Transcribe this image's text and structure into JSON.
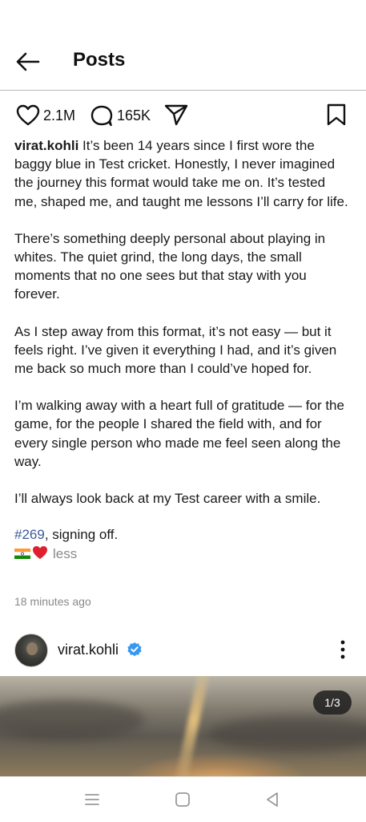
{
  "header": {
    "title": "Posts"
  },
  "actions": {
    "likes": "2.1M",
    "comments": "165K"
  },
  "caption": {
    "username": "virat.kohli",
    "paragraphs": [
      "It’s been 14 years since I first wore the baggy blue in Test cricket. Honestly, I never imagined the journey this format would take me on. It’s tested me, shaped me, and taught me lessons I’ll carry for life.",
      "There’s something deeply personal about playing in whites. The quiet grind, the long days, the small moments that no one sees but that stay with you forever.",
      "As I step away from this format, it’s not easy — but it feels right. I’ve given it everything I had, and it’s given me back so much more than I could’ve hoped for.",
      "I’m walking away with a heart full of gratitude — for the game, for the people I shared the field with, and for every single person who made me feel seen along the way.",
      "I’ll always look back at my Test career with a smile."
    ],
    "hashtag": "#269",
    "hashtag_suffix": ", signing off.",
    "less": "less",
    "emoji_icons": [
      "india-flag-icon",
      "red-heart-icon"
    ]
  },
  "timestamp": "18 minutes ago",
  "post": {
    "username": "virat.kohli",
    "verified": true,
    "image_counter": "1/3"
  },
  "colors": {
    "link": "#3b5b9b",
    "muted": "#8a8a8a",
    "verified": "#3897f0"
  }
}
